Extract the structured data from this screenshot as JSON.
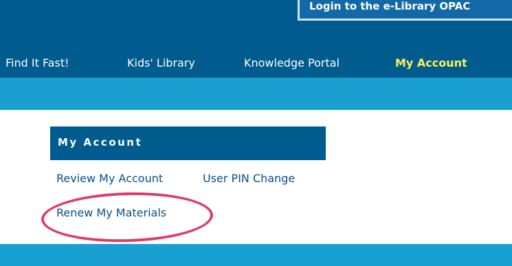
{
  "header": {
    "login_button_label": "Login to the e-Library OPAC"
  },
  "nav": {
    "items": [
      {
        "label": "Find It Fast!"
      },
      {
        "label": "Kids' Library"
      },
      {
        "label": "Knowledge Portal"
      },
      {
        "label": "My Account",
        "active": true
      }
    ]
  },
  "account_panel": {
    "title": "My Account",
    "links": [
      {
        "label": "Review My Account"
      },
      {
        "label": "User PIN Change"
      },
      {
        "label": "Renew My Materials",
        "highlighted": true
      }
    ]
  },
  "colors": {
    "header_blue": "#005b8f",
    "band_light_blue": "#1aa0d0",
    "active_nav": "#fff05a",
    "link_blue": "#06508a",
    "highlight_pink": "#e03b68"
  }
}
